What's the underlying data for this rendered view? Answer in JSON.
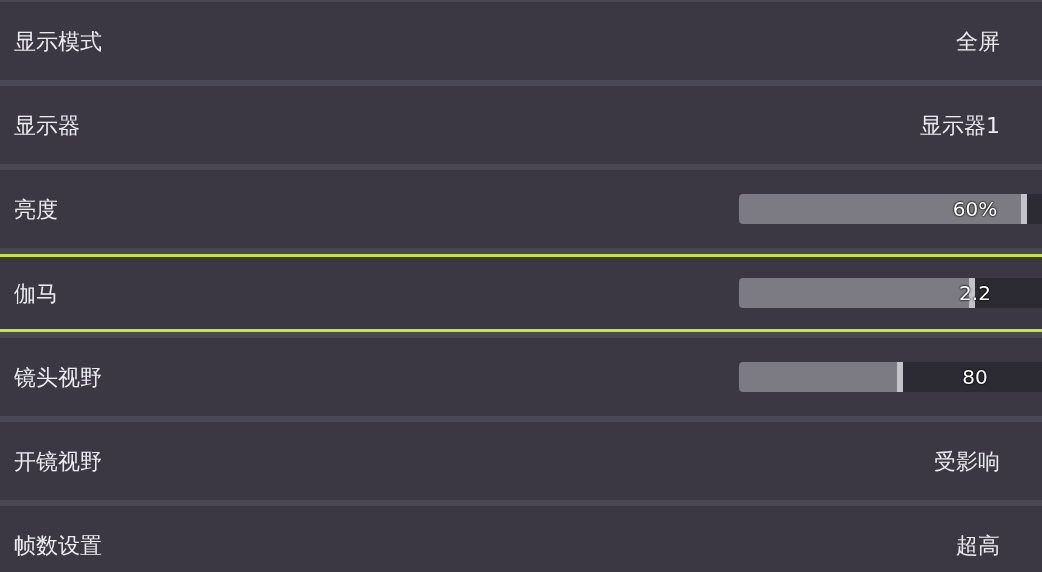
{
  "settings": [
    {
      "kind": "value",
      "label": "显示模式",
      "value": "全屏",
      "selected": false
    },
    {
      "kind": "value",
      "label": "显示器",
      "value": "显示器1",
      "selected": false
    },
    {
      "kind": "slider",
      "label": "亮度",
      "value": "60%",
      "level": 0.95,
      "selected": false
    },
    {
      "kind": "slider",
      "label": "伽马",
      "value": "2.2",
      "level": 0.78,
      "selected": true
    },
    {
      "kind": "slider",
      "label": "镜头视野",
      "value": "80",
      "level": 0.54,
      "selected": false
    },
    {
      "kind": "value",
      "label": "开镜视野",
      "value": "受影响",
      "selected": false
    },
    {
      "kind": "value",
      "label": "帧数设置",
      "value": "超高",
      "selected": false
    }
  ]
}
